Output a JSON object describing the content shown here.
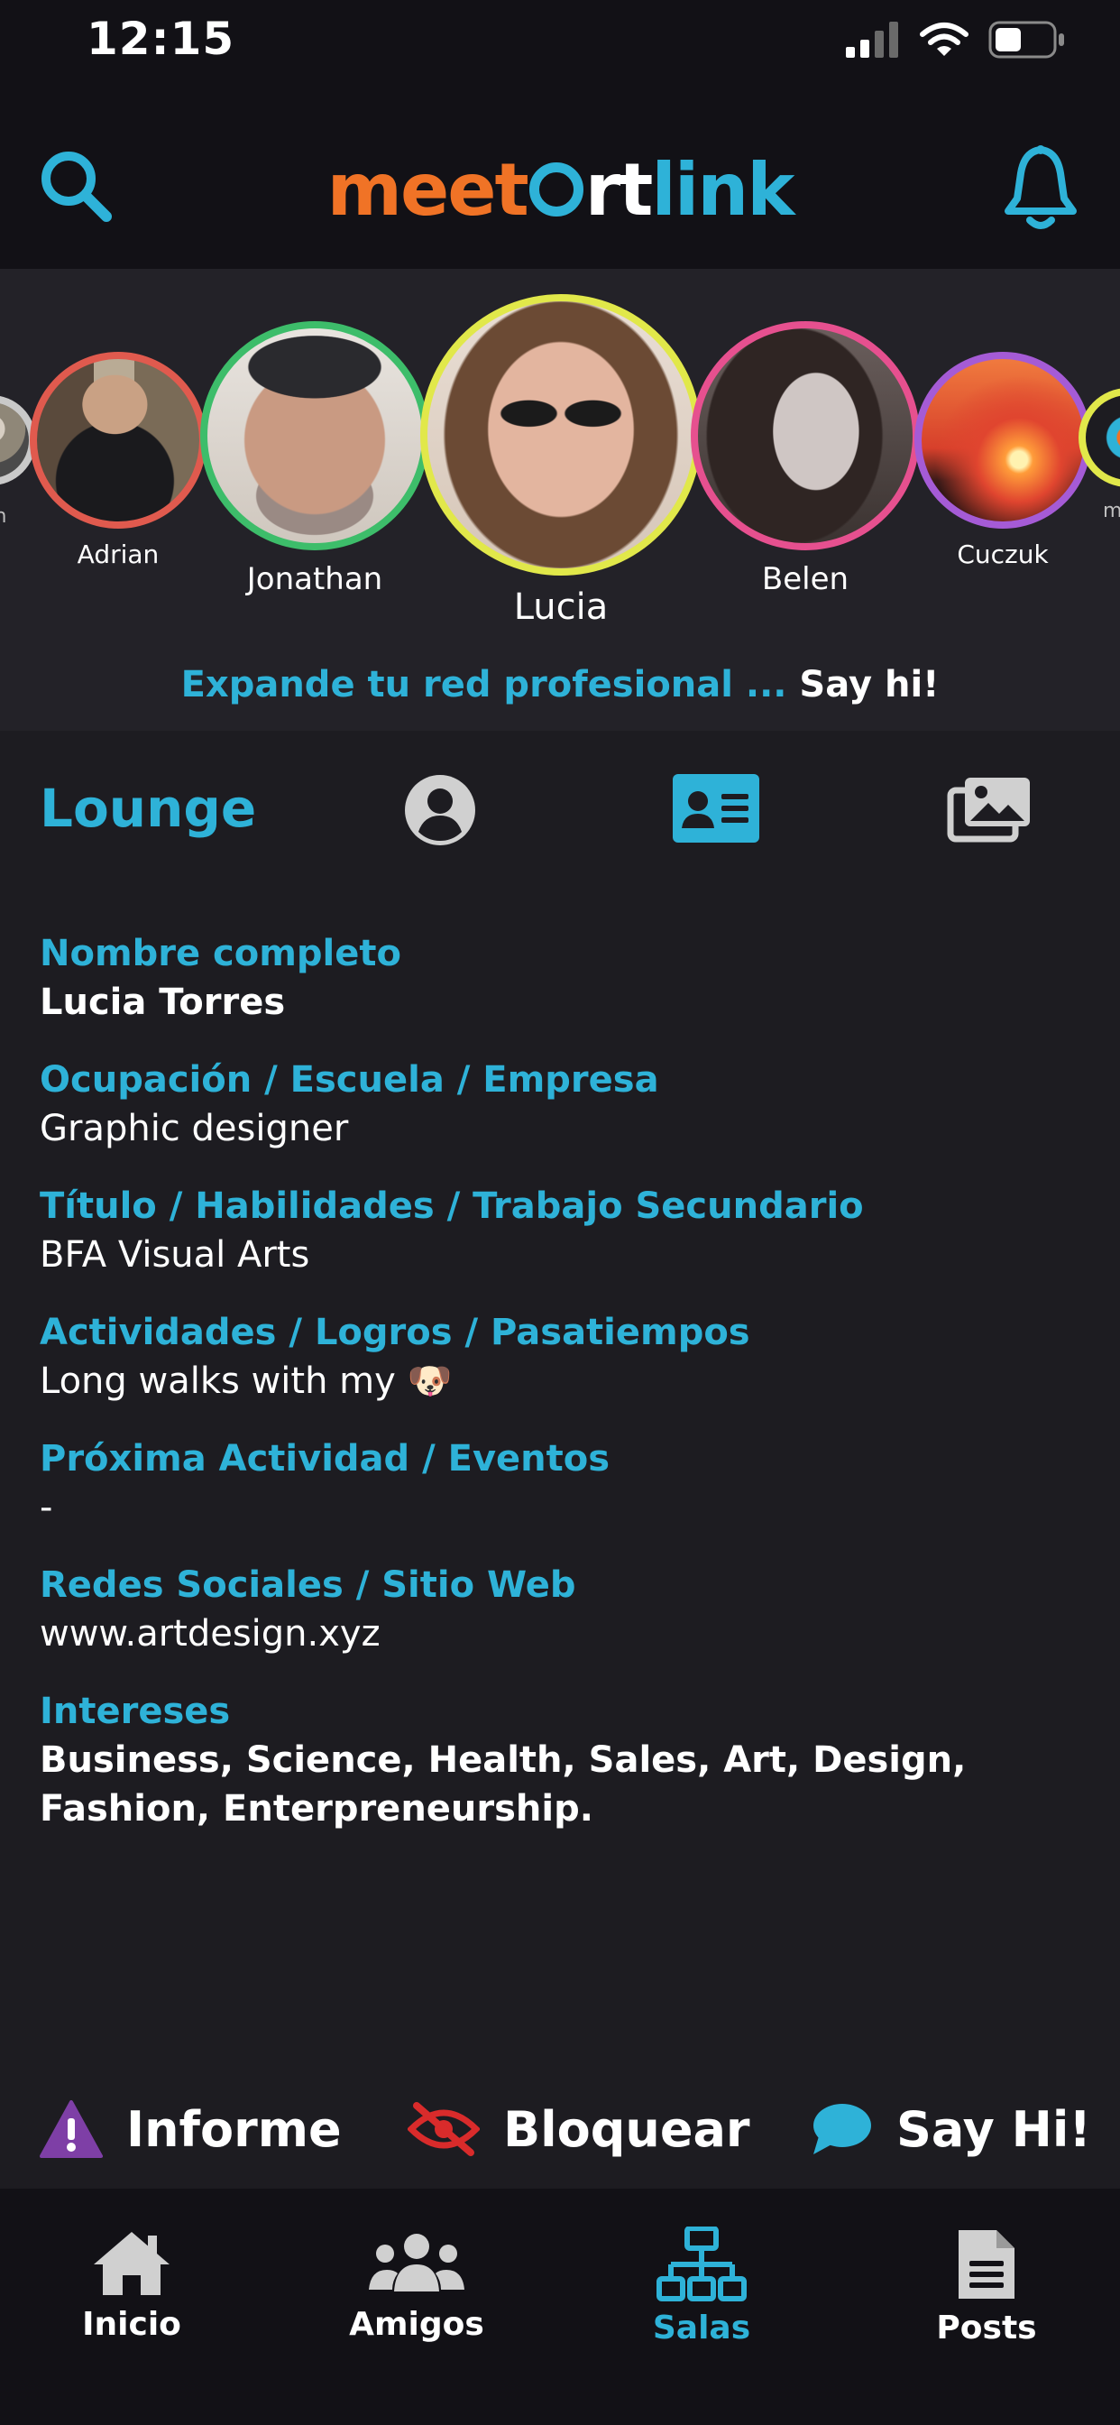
{
  "status_bar": {
    "time": "12:15"
  },
  "header": {
    "logo": {
      "part1": "meet",
      "part2": "rt",
      "part3": "link"
    }
  },
  "stories": [
    {
      "name": "...n",
      "ring_color": "#c9c9c9"
    },
    {
      "name": "Adrian",
      "ring_color": "#e05a4e"
    },
    {
      "name": "Jonathan",
      "ring_color": "#3dbd6a"
    },
    {
      "name": "Lucia",
      "ring_color": "#e1e84a"
    },
    {
      "name": "Belen",
      "ring_color": "#e6508f"
    },
    {
      "name": "Cuczuk",
      "ring_color": "#a55bd6"
    },
    {
      "name": "me...",
      "ring_color": "#e1e84a"
    }
  ],
  "tagline": {
    "main": "Expande tu red profesional ... ",
    "cta": "Say hi!"
  },
  "tabs": {
    "title": "Lounge",
    "active": "id-card"
  },
  "fields": [
    {
      "label": "Nombre completo",
      "value": "Lucia Torres"
    },
    {
      "label": "Ocupación / Escuela / Empresa",
      "value": "Graphic designer"
    },
    {
      "label": "Título / Habilidades / Trabajo Secundario",
      "value": "BFA Visual Arts"
    },
    {
      "label": "Actividades / Logros / Pasatiempos",
      "value": "Long walks with my 🐶"
    },
    {
      "label": "Próxima Actividad / Eventos",
      "value": "-"
    },
    {
      "label": "Redes Sociales / Sitio Web",
      "value": "www.artdesign.xyz"
    },
    {
      "label": "Intereses",
      "value": "Business, Science, Health, Sales, Art, Design, Fashion, Enterpreneurship."
    }
  ],
  "actions": {
    "report": "Informe",
    "block": "Bloquear",
    "say_hi": "Say Hi!"
  },
  "nav": {
    "home": "Inicio",
    "friends": "Amigos",
    "rooms": "Salas",
    "posts": "Posts",
    "active": "rooms"
  },
  "colors": {
    "accent": "#2eb2d8",
    "logo_orange": "#f07326",
    "report_icon": "#7e3fa6",
    "block_icon": "#d92b2b",
    "background": "#1d1c21",
    "header_bg": "#121116"
  }
}
